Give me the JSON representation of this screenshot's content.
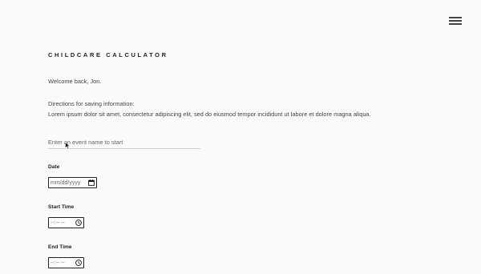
{
  "header": {
    "menu_icon": "hamburger-menu-icon"
  },
  "page": {
    "title": "CHILDCARE CALCULATOR",
    "welcome": "Welcome back, Jon.",
    "directions_title": "Directions for saving information:",
    "directions_body": "Lorem ipsum dolor sit amet, consectetur adipiscing elit, sed do eiusmod tempor incididunt ut labore et dolore magna aliqua."
  },
  "form": {
    "event_name": {
      "placeholder": "Enter an event name to start",
      "value": ""
    },
    "date": {
      "label": "Date",
      "placeholder": "mm/dd/yyyy",
      "icon": "calendar-icon"
    },
    "start_time": {
      "label": "Start Time",
      "placeholder": "--:-- --",
      "icon": "clock-icon"
    },
    "end_time": {
      "label": "End Time",
      "placeholder": "--:-- --",
      "icon": "clock-icon"
    }
  },
  "colors": {
    "background": "#fafafa",
    "text": "#333333",
    "border": "#222222",
    "underline": "#cfcfcf"
  }
}
